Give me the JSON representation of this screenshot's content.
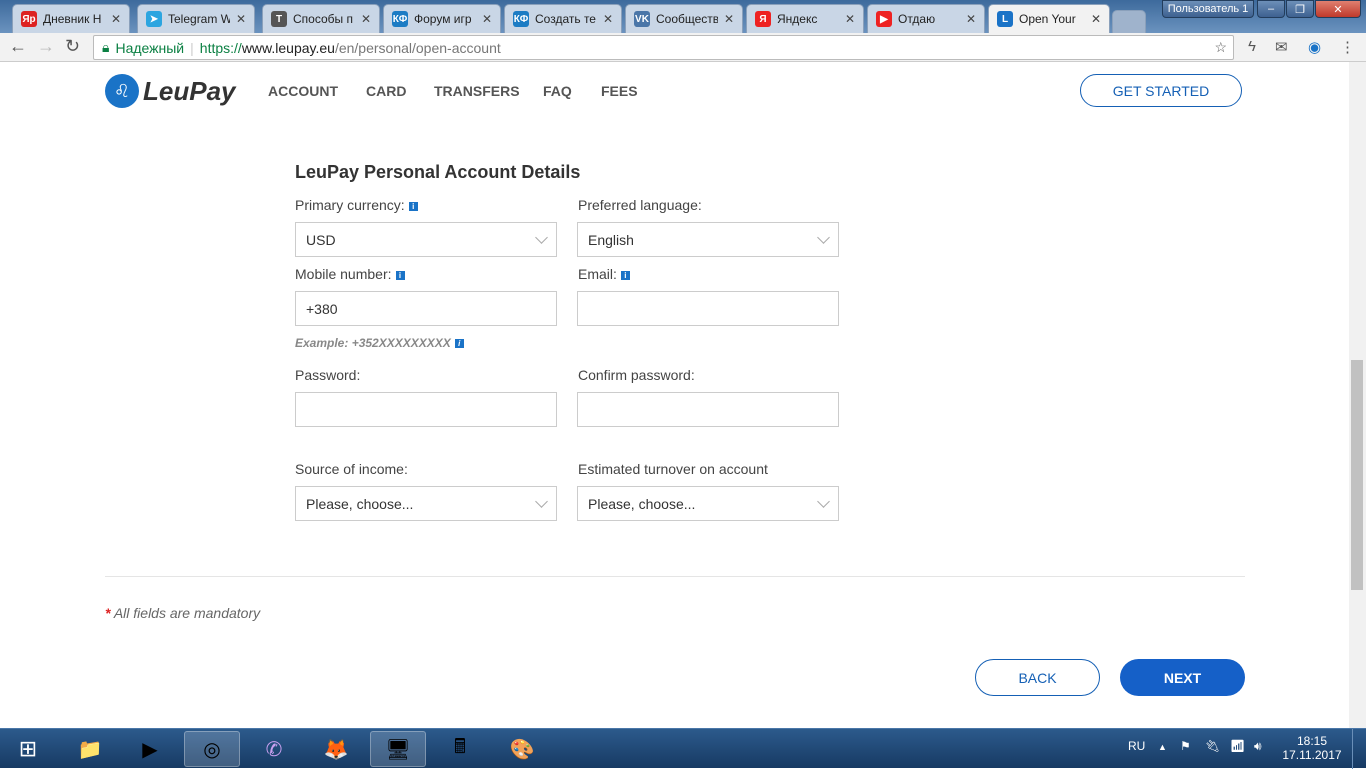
{
  "browser": {
    "tabs": [
      {
        "title": "Дневник Н",
        "icon": "Яр",
        "color": "#d22"
      },
      {
        "title": "Telegram W",
        "icon": "➤",
        "color": "#2ca5e0"
      },
      {
        "title": "Способы п",
        "icon": "T",
        "color": "#555"
      },
      {
        "title": "Форум игр",
        "icon": "КФ",
        "color": "#1c7cc4"
      },
      {
        "title": "Создать те",
        "icon": "КФ",
        "color": "#1c7cc4"
      },
      {
        "title": "Сообществ",
        "icon": "VK",
        "color": "#4a76a8"
      },
      {
        "title": "Яндекс",
        "icon": "Я",
        "color": "#e22"
      },
      {
        "title": "Отдаю",
        "icon": "▶",
        "color": "#e22"
      },
      {
        "title": "Open Your",
        "icon": "L",
        "color": "#1a73c7"
      }
    ],
    "user_label": "Пользователь 1",
    "secure_label": "Надежный",
    "url_scheme": "https://",
    "url_host": "www.leupay.eu",
    "url_path": "/en/personal/open-account"
  },
  "site": {
    "logo": "LeuPay",
    "menu": [
      "ACCOUNT",
      "CARD",
      "TRANSFERS",
      "FAQ",
      "FEES"
    ],
    "get_started": "GET STARTED"
  },
  "form": {
    "heading": "LeuPay Personal Account Details",
    "primary_currency_label": "Primary currency:",
    "primary_currency_value": "USD",
    "language_label": "Preferred language:",
    "language_value": "English",
    "mobile_label": "Mobile number:",
    "mobile_value": "+380",
    "email_label": "Email:",
    "email_value": "",
    "mobile_example": "Example: +352XXXXXXXXX",
    "password_label": "Password:",
    "confirm_label": "Confirm password:",
    "income_label": "Source of income:",
    "income_value": "Please, choose...",
    "turnover_label": "Estimated turnover on account",
    "turnover_value": "Please, choose...",
    "mandatory_star": "*",
    "mandatory_note": "All fields are mandatory",
    "back": "BACK",
    "next": "NEXT"
  },
  "taskbar": {
    "lang": "RU",
    "time": "18:15",
    "date": "17.11.2017"
  }
}
